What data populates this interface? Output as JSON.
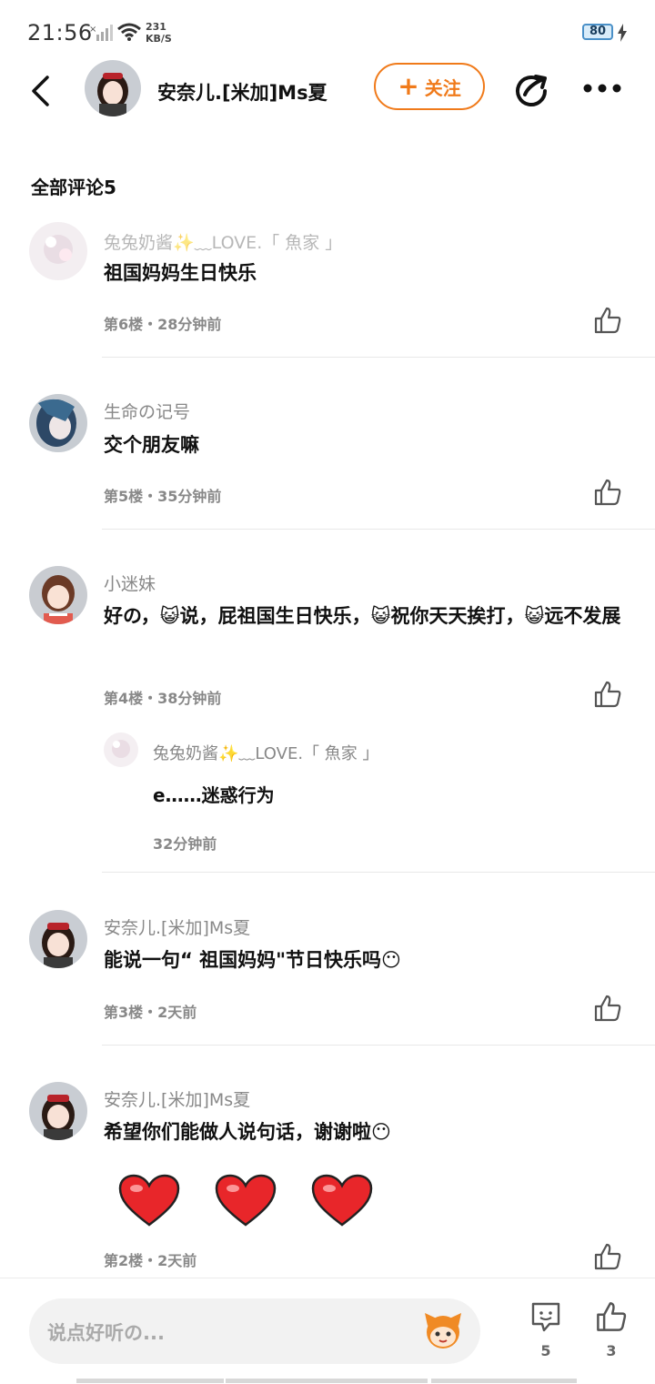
{
  "status": {
    "time": "21:56",
    "speed_value": "231",
    "speed_unit": "KB/S",
    "battery": "80"
  },
  "header": {
    "author": "安奈儿.[米加]Ms夏",
    "follow_label": "关注"
  },
  "section_title": "全部评论5",
  "comments": [
    {
      "user": "兔兔奶酱✨﹏LOVE.「 魚家 」",
      "text": "祖国妈妈生日快乐",
      "meta": "第6楼・28分钟前"
    },
    {
      "user": "生命の记号",
      "text": "交个朋友嘛",
      "meta": "第5楼・35分钟前"
    },
    {
      "user": "小迷妹",
      "text": "好の，😺说，屁祖国生日快乐，😺祝你天天挨打，😺远不发展",
      "meta": "第4楼・38分钟前",
      "reply": {
        "user": "兔兔奶酱✨﹏LOVE.「 魚家 」",
        "text": "e……迷惑行为",
        "time": "32分钟前"
      }
    },
    {
      "user": "安奈儿.[米加]Ms夏",
      "text": "能说一句“ 祖国妈妈\"节日快乐吗😶",
      "meta": "第3楼・2天前"
    },
    {
      "user": "安奈儿.[米加]Ms夏",
      "text": "希望你们能做人说句话，谢谢啦😶",
      "meta": "第2楼・2天前"
    }
  ],
  "bottom": {
    "placeholder": "说点好听の...",
    "comment_count": "5",
    "like_count": "3"
  },
  "colors": {
    "accent": "#f07a1a",
    "muted": "#888888"
  }
}
